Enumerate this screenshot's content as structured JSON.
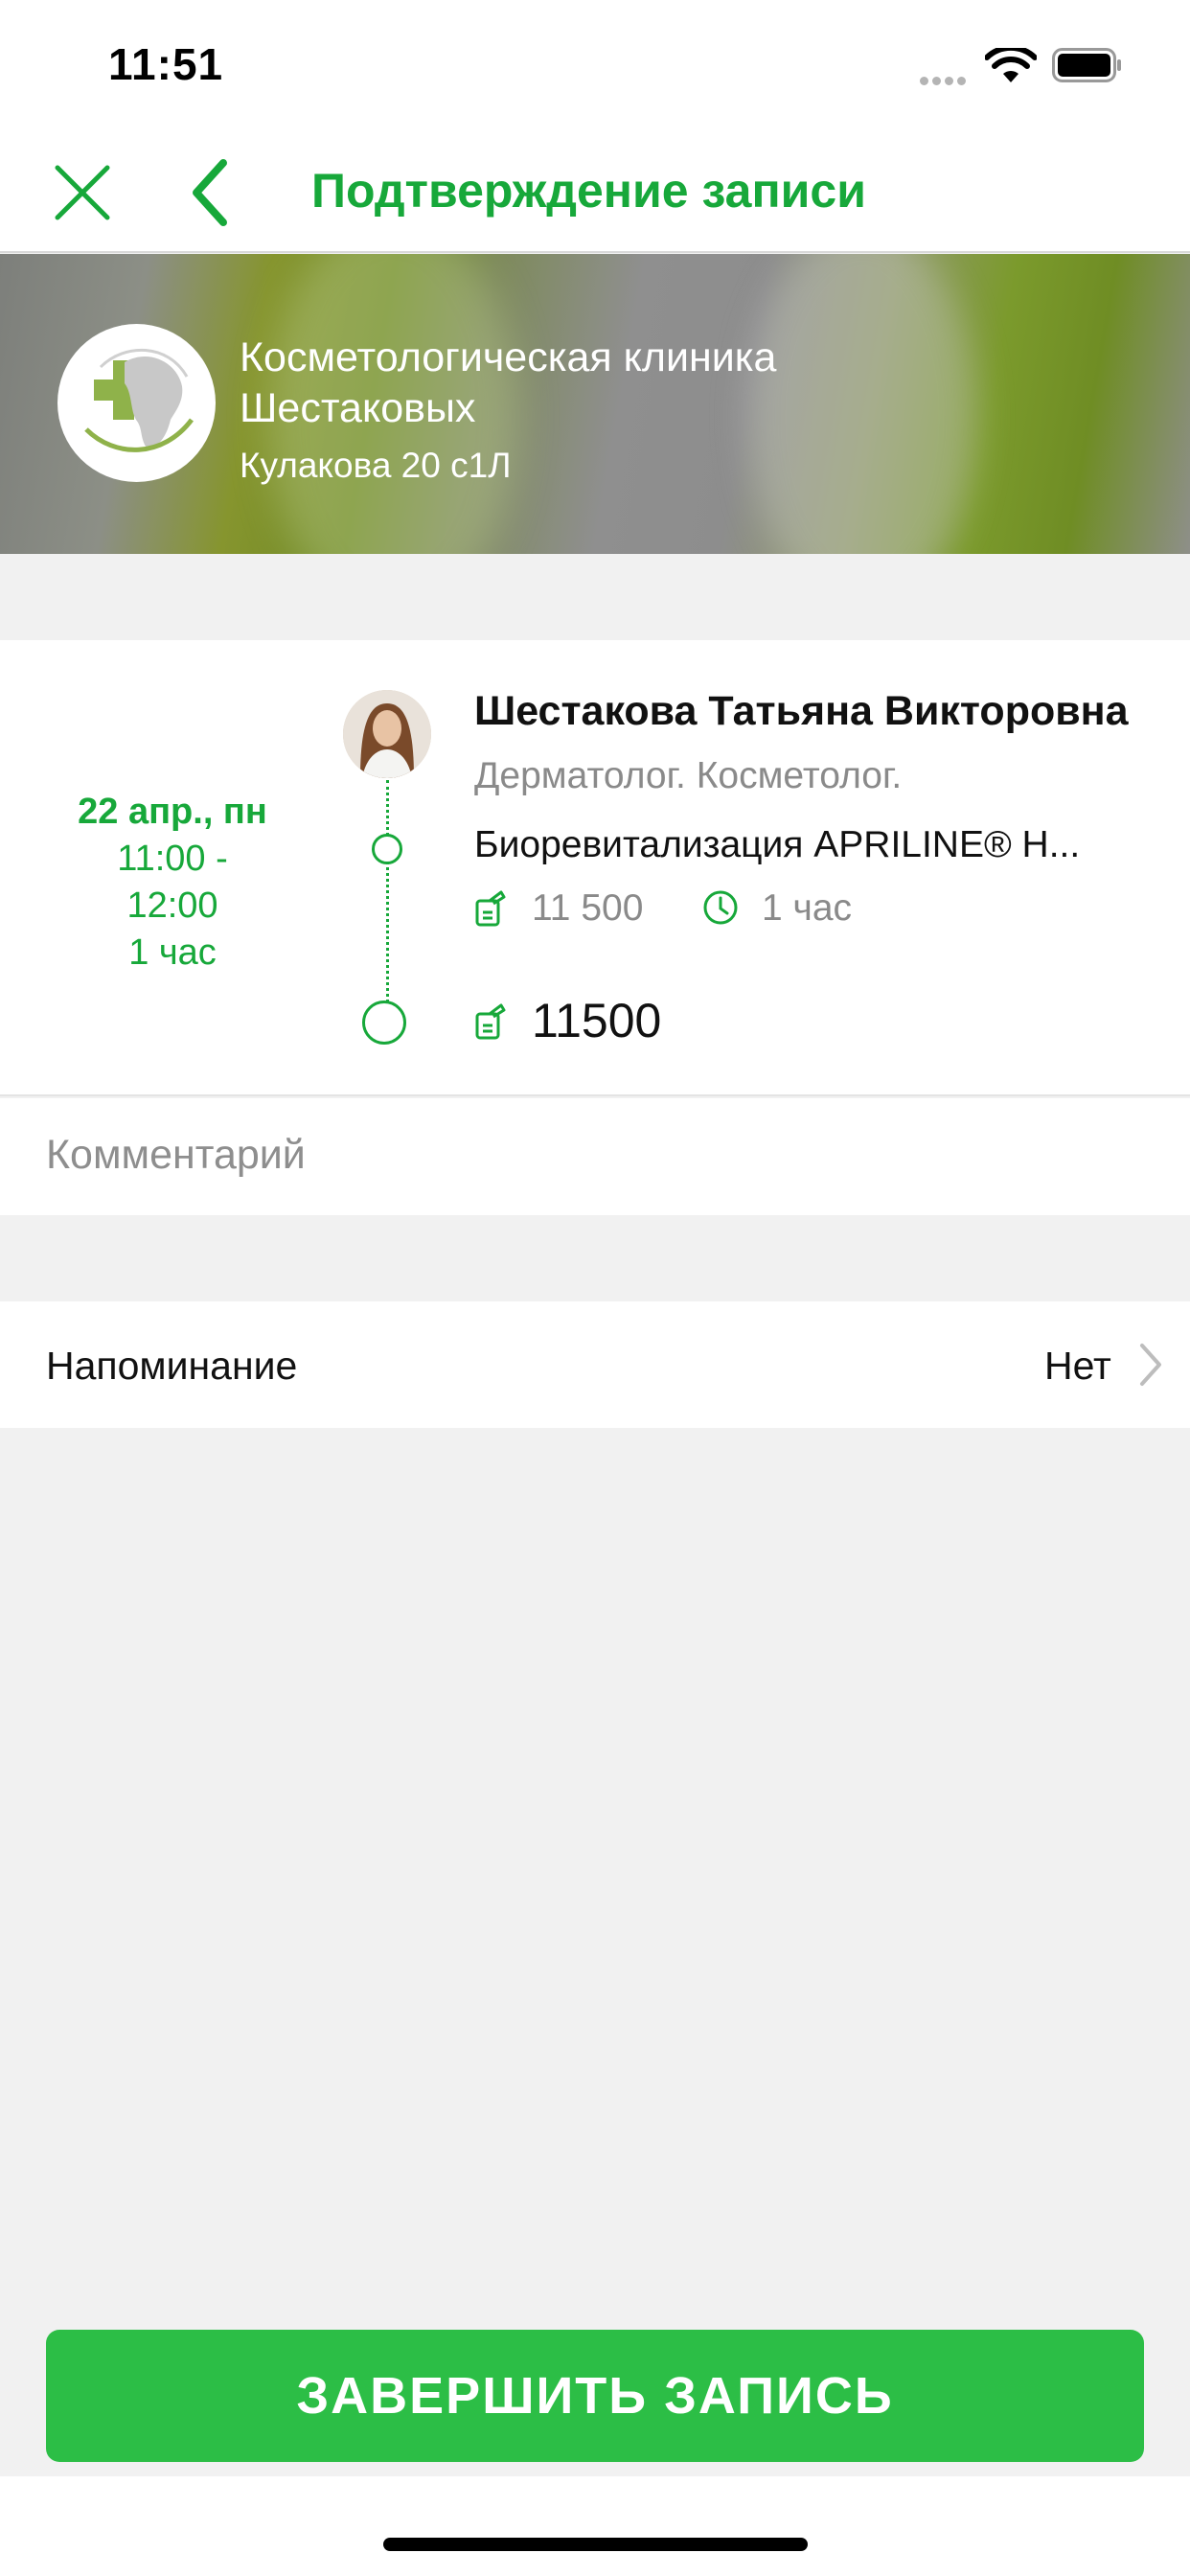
{
  "status_bar": {
    "time": "11:51"
  },
  "nav": {
    "title": "Подтверждение записи"
  },
  "clinic": {
    "name": "Косметологическая клиника Шестаковых",
    "address": "Кулакова 20 с1Л"
  },
  "appointment": {
    "date": "22 апр., пн",
    "time_range": "11:00 - 12:00",
    "duration": "1 час",
    "doctor_name": "Шестакова Татьяна Викторовна",
    "specialty": "Дерматолог. Косметолог.",
    "service": "Биоревитализация APRILINE® H...",
    "service_price": "11 500",
    "service_duration": "1 час",
    "total": "11500"
  },
  "comment": {
    "placeholder": "Комментарий",
    "value": ""
  },
  "reminder": {
    "label": "Напоминание",
    "value": "Нет"
  },
  "finish_button": "ЗАВЕРШИТЬ ЗАПИСЬ",
  "colors": {
    "accent": "#17a83a",
    "button": "#2cbe46",
    "background": "#f1f1f1"
  },
  "icons": [
    "close-icon",
    "back-arrow-icon",
    "wifi-icon",
    "battery-icon",
    "price-tag-icon",
    "clock-icon",
    "chevron-right-icon"
  ]
}
